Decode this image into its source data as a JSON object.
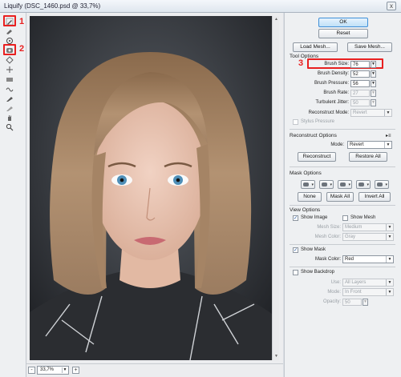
{
  "window": {
    "title": "Liquify (DSC_1460.psd @ 33,7%)",
    "close_glyph": "x"
  },
  "annotations": [
    "1",
    "2",
    "3"
  ],
  "tools": [
    "forward-warp-tool",
    "reconstruct-tool",
    "twirl-clockwise-tool",
    "pucker-tool",
    "bloat-tool",
    "push-left-tool",
    "mirror-tool",
    "turbulence-tool",
    "freeze-mask-tool",
    "thaw-mask-tool",
    "hand-tool",
    "zoom-tool"
  ],
  "canvas": {
    "image": "portrait of woman with shoulder-length light brown hair and blue eyes"
  },
  "status": {
    "zoom_out": "-",
    "zoom_in": "+",
    "zoom": "33,7%"
  },
  "panel": {
    "ok": "OK",
    "reset": "Reset",
    "load_mesh": "Load Mesh...",
    "save_mesh": "Save Mesh...",
    "tool_options": {
      "heading": "Tool Options",
      "brush_size_label": "Brush Size:",
      "brush_size": "76",
      "brush_density_label": "Brush Density:",
      "brush_density": "52",
      "brush_pressure_label": "Brush Pressure:",
      "brush_pressure": "56",
      "brush_rate_label": "Brush Rate:",
      "brush_rate": "27",
      "turbulent_jitter_label": "Turbulent Jitter:",
      "turbulent_jitter": "50",
      "reconstruct_mode_label": "Reconstruct Mode:",
      "reconstruct_mode": "Revert",
      "stylus_pressure_label": "Stylus Pressure"
    },
    "reconstruct_options": {
      "heading": "Reconstruct Options",
      "mode_label": "Mode:",
      "mode": "Revert",
      "reconstruct": "Reconstruct",
      "restore_all": "Restore All"
    },
    "mask_options": {
      "heading": "Mask Options",
      "none": "None",
      "mask_all": "Mask All",
      "invert_all": "Invert All"
    },
    "view_options": {
      "heading": "View Options",
      "show_image_label": "Show Image",
      "show_image": true,
      "show_mesh_label": "Show Mesh",
      "show_mesh": false,
      "mesh_size_label": "Mesh Size:",
      "mesh_size": "Medium",
      "mesh_color_label": "Mesh Color:",
      "mesh_color": "Gray",
      "show_mask_label": "Show Mask",
      "show_mask": true,
      "mask_color_label": "Mask Color:",
      "mask_color": "Red",
      "show_backdrop_label": "Show Backdrop",
      "show_backdrop": false,
      "use_label": "Use:",
      "use": "All Layers",
      "mode_label": "Mode:",
      "mode": "In Front",
      "opacity_label": "Opacity:",
      "opacity": "50"
    }
  },
  "colors": {
    "highlight": "#e82020",
    "primary_button": "#bfe0f7",
    "panel_bg": "#eef0f2"
  }
}
